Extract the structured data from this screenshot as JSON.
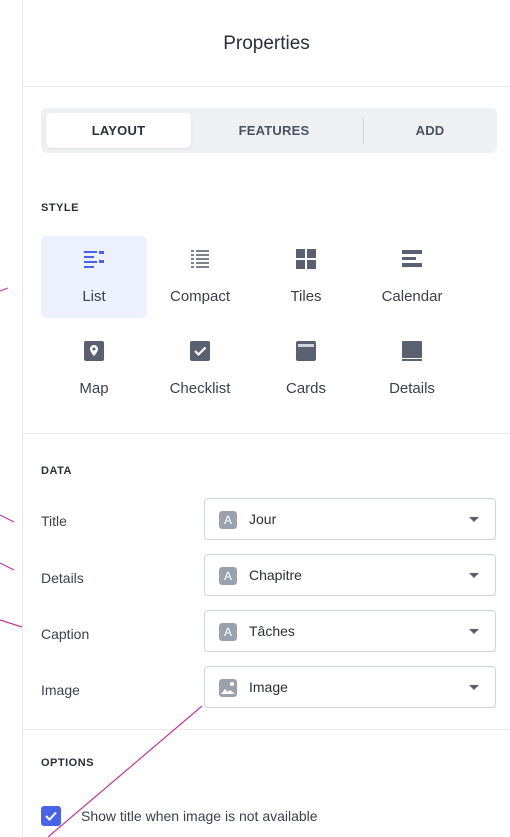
{
  "header": {
    "title": "Properties"
  },
  "tabs": [
    {
      "label": "LAYOUT",
      "active": true
    },
    {
      "label": "FEATURES",
      "active": false
    },
    {
      "label": "ADD",
      "active": false
    }
  ],
  "style_section": {
    "label": "STYLE",
    "items": [
      {
        "label": "List",
        "icon": "list-icon",
        "selected": true
      },
      {
        "label": "Compact",
        "icon": "compact-list-icon",
        "selected": false
      },
      {
        "label": "Tiles",
        "icon": "tiles-icon",
        "selected": false
      },
      {
        "label": "Calendar",
        "icon": "calendar-icon",
        "selected": false
      },
      {
        "label": "Map",
        "icon": "map-pin-icon",
        "selected": false
      },
      {
        "label": "Checklist",
        "icon": "checkbox-icon",
        "selected": false
      },
      {
        "label": "Cards",
        "icon": "card-icon",
        "selected": false
      },
      {
        "label": "Details",
        "icon": "details-icon",
        "selected": false
      }
    ]
  },
  "data_section": {
    "label": "DATA",
    "rows": [
      {
        "label": "Title",
        "value": "Jour",
        "type_icon": "text-type-icon"
      },
      {
        "label": "Details",
        "value": "Chapitre",
        "type_icon": "text-type-icon"
      },
      {
        "label": "Caption",
        "value": "Tâches",
        "type_icon": "text-type-icon"
      },
      {
        "label": "Image",
        "value": "Image",
        "type_icon": "image-type-icon"
      }
    ]
  },
  "options_section": {
    "label": "OPTIONS",
    "show_title_checkbox": {
      "label": "Show title when image is not available",
      "checked": true
    }
  },
  "colors": {
    "accent": "#4a63e6",
    "selected_bg": "#edf1ff",
    "icon_gray": "#5a6070",
    "annotation_line": "#c0399a"
  }
}
